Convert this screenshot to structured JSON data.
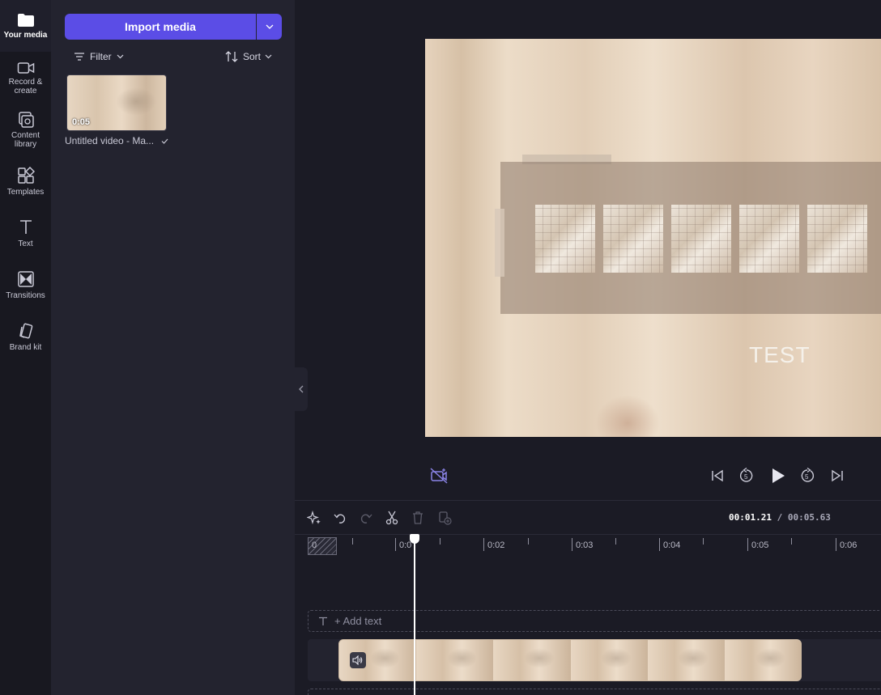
{
  "nav": {
    "items": [
      {
        "label": "Your media"
      },
      {
        "label": "Record &\ncreate"
      },
      {
        "label": "Content\nlibrary"
      },
      {
        "label": "Templates"
      },
      {
        "label": "Text"
      },
      {
        "label": "Transitions"
      },
      {
        "label": "Brand kit"
      }
    ]
  },
  "media": {
    "import_label": "Import media",
    "filter_label": "Filter",
    "sort_label": "Sort",
    "items": [
      {
        "duration": "0:05",
        "name": "Untitled video - Ma..."
      }
    ]
  },
  "preview": {
    "caption": "TEST"
  },
  "timeline": {
    "current_time": "00:01.21",
    "separator": " / ",
    "total_time": "00:05.63",
    "ruler_labels": [
      "0",
      "0:0",
      "0:02",
      "0:03",
      "0:04",
      "0:05",
      "0:06"
    ],
    "add_text_label": "+ Add text"
  },
  "colors": {
    "accent": "#5b4de6",
    "background": "#1b1b25",
    "panel": "#23232f",
    "rail": "#181820"
  }
}
